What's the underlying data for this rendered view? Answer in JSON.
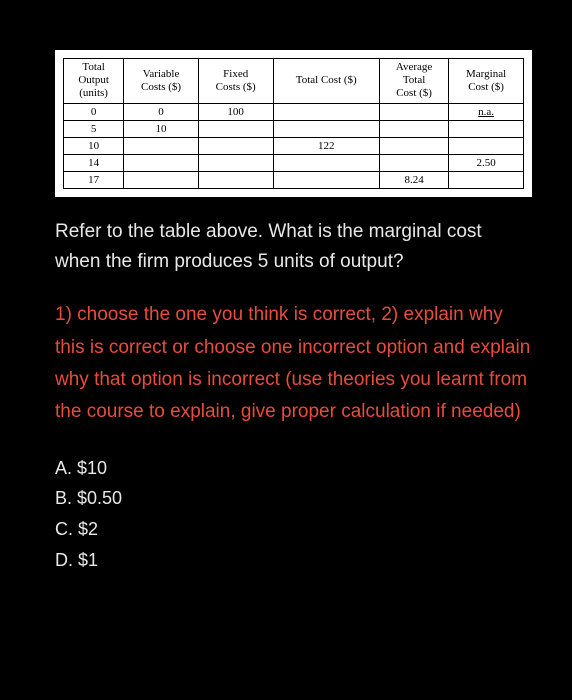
{
  "table": {
    "headers": {
      "col1_line1": "Total",
      "col1_line2": "Output",
      "col1_line3": "(units)",
      "col2_line1": "Variable",
      "col2_line2": "Costs ($)",
      "col3_line1": "Fixed",
      "col3_line2": "Costs ($)",
      "col4_line1": "Total Cost ($)",
      "col5_line1": "Average",
      "col5_line2": "Total",
      "col5_line3": "Cost ($)",
      "col6_line1": "Marginal",
      "col6_line2": "Cost ($)"
    },
    "rows": [
      {
        "output": "0",
        "variable": "0",
        "fixed": "100",
        "total": "",
        "atc": "",
        "mc": "n.a."
      },
      {
        "output": "5",
        "variable": "10",
        "fixed": "",
        "total": "",
        "atc": "",
        "mc": ""
      },
      {
        "output": "10",
        "variable": "",
        "fixed": "",
        "total": "122",
        "atc": "",
        "mc": ""
      },
      {
        "output": "14",
        "variable": "",
        "fixed": "",
        "total": "",
        "atc": "",
        "mc": "2.50"
      },
      {
        "output": "17",
        "variable": "",
        "fixed": "",
        "total": "",
        "atc": "8.24",
        "mc": ""
      }
    ]
  },
  "question": "Refer to the table above. What is the marginal cost when the firm produces 5 units of output?",
  "instructions": "1) choose the one you think is correct, 2) explain why this is correct or choose one incorrect option and explain why that option is incorrect (use theories you learnt from the course to explain, give proper calculation if needed)",
  "options": {
    "a": "A.  $10",
    "b": "B.  $0.50",
    "c": "C.  $2",
    "d": "D.  $1"
  }
}
